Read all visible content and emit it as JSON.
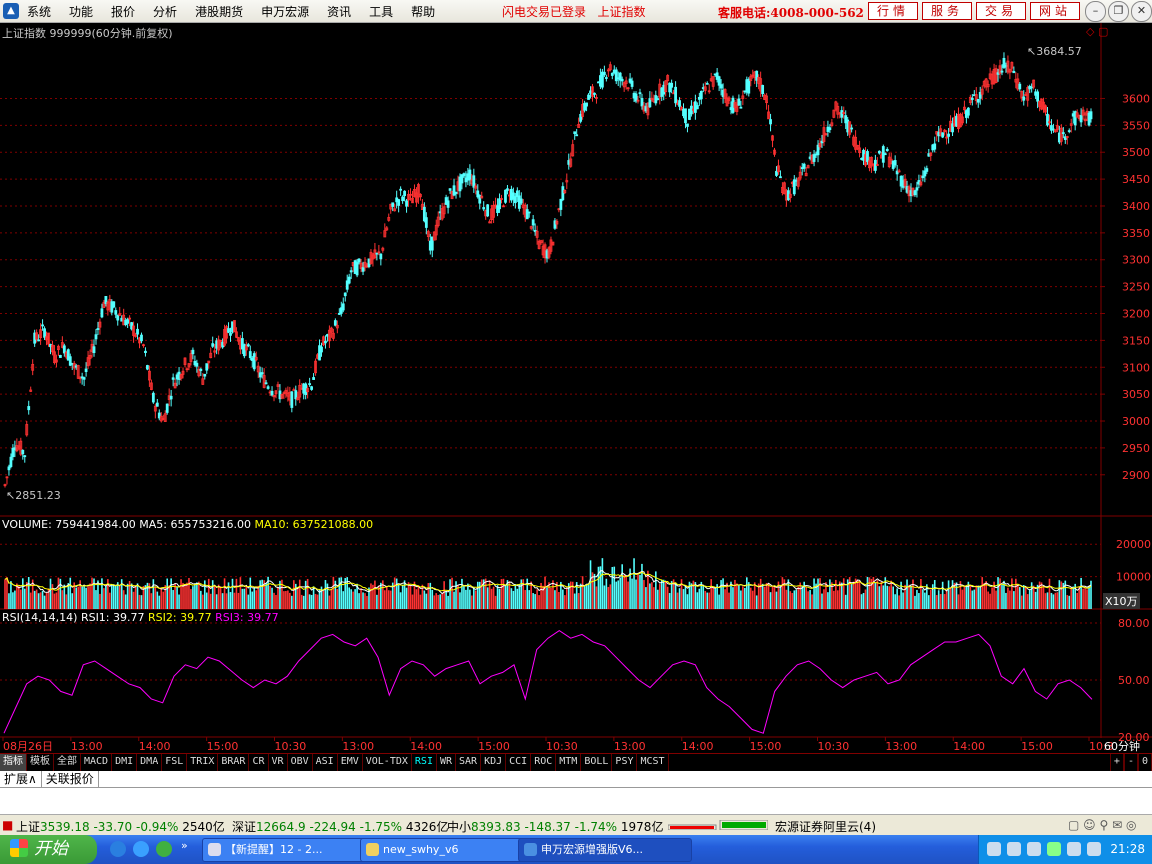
{
  "menubar": {
    "items": [
      "系统",
      "功能",
      "报价",
      "分析",
      "港股期货",
      "申万宏源",
      "资讯",
      "工具",
      "帮助"
    ],
    "login_status": "闪电交易已登录   上证指数",
    "hotline": "客服电话:4008-000-562",
    "quick_buttons": [
      "行情",
      "服务",
      "交易",
      "网站"
    ]
  },
  "chart": {
    "title": "上证指数 999999(60分钟.前复权)",
    "high_label": "3684.57",
    "low_label": "2851.23",
    "volume_header": {
      "volume": "VOLUME: 759441984.00",
      "ma5": "MA5: 655753216.00",
      "ma10": "MA10: 637521088.00"
    },
    "rsi_header": {
      "params": "RSI(14,14,14)",
      "rsi1": "RSI1: 39.77",
      "rsi2": "RSI2: 39.77",
      "rsi3": "RSI3: 39.77"
    },
    "volume_unit": "X10万",
    "time_axis": [
      "08月26日",
      "13:00",
      "14:00",
      "15:00",
      "10:30",
      "13:00",
      "14:00",
      "15:00",
      "10:30",
      "13:00",
      "14:00",
      "15:00",
      "10:30",
      "13:00",
      "14:00",
      "15:00",
      "10:3"
    ],
    "period_label": "60分钟",
    "colors": {
      "up": "#ff3232",
      "down": "#54ffff",
      "grid": "#800000",
      "ma5": "#ffffff",
      "ma10": "#ffff00",
      "rsi": "#ff00ff"
    }
  },
  "chart_data": [
    {
      "type": "candlestick",
      "title": "上证指数 999999(60分钟.前复权)",
      "ylim": [
        2851.23,
        3684.57
      ],
      "y_ticks": [
        2900,
        2950,
        3000,
        3050,
        3100,
        3150,
        3200,
        3250,
        3300,
        3350,
        3400,
        3450,
        3500,
        3550,
        3600
      ],
      "annotations": {
        "high": 3684.57,
        "low": 2851.23
      },
      "close_trajectory": [
        2880,
        2960,
        2940,
        3150,
        3170,
        3120,
        3140,
        3100,
        3080,
        3140,
        3220,
        3210,
        3190,
        3170,
        3140,
        3040,
        3000,
        3070,
        3100,
        3120,
        3080,
        3130,
        3150,
        3180,
        3140,
        3120,
        3080,
        3060,
        3050,
        3040,
        3060,
        3070,
        3140,
        3160,
        3200,
        3280,
        3290,
        3300,
        3310,
        3390,
        3420,
        3410,
        3430,
        3320,
        3380,
        3420,
        3440,
        3460,
        3420,
        3380,
        3400,
        3430,
        3410,
        3380,
        3330,
        3310,
        3390,
        3470,
        3560,
        3600,
        3620,
        3660,
        3640,
        3630,
        3600,
        3580,
        3610,
        3630,
        3600,
        3560,
        3590,
        3620,
        3640,
        3600,
        3580,
        3620,
        3640,
        3600,
        3470,
        3420,
        3440,
        3470,
        3500,
        3540,
        3580,
        3560,
        3520,
        3490,
        3480,
        3500,
        3470,
        3440,
        3420,
        3460,
        3520,
        3540,
        3550,
        3570,
        3600,
        3620,
        3640,
        3660,
        3650,
        3600,
        3620,
        3580,
        3540,
        3530,
        3560,
        3570,
        3560
      ]
    },
    {
      "type": "bar",
      "title": "VOLUME",
      "values": [
        759441984.0
      ],
      "series": [
        {
          "name": "MA5",
          "values": [
            655753216.0
          ]
        },
        {
          "name": "MA10",
          "values": [
            637521088.0
          ]
        }
      ],
      "y_ticks": [
        10000,
        20000
      ],
      "ylabel": "X10万"
    },
    {
      "type": "line",
      "title": "RSI(14,14,14)",
      "ylim": [
        20,
        80
      ],
      "y_ticks": [
        20.0,
        50.0,
        80.0
      ],
      "series": [
        {
          "name": "RSI1",
          "values": [
            22,
            35,
            48,
            52,
            50,
            44,
            42,
            58,
            60,
            56,
            52,
            48,
            46,
            40,
            38,
            52,
            58,
            56,
            62,
            60,
            55,
            50,
            46,
            50,
            48,
            52,
            60,
            66,
            72,
            74,
            70,
            68,
            72,
            62,
            42,
            56,
            60,
            58,
            52,
            56,
            58,
            60,
            48,
            52,
            54,
            58,
            40,
            66,
            72,
            76,
            72,
            74,
            70,
            68,
            62,
            56,
            50,
            46,
            52,
            58,
            60,
            58,
            46,
            40,
            36,
            30,
            24,
            22,
            44,
            52,
            58,
            60,
            56,
            50,
            46,
            50,
            52,
            54,
            48,
            50,
            58,
            62,
            66,
            70,
            70,
            72,
            74,
            68,
            52,
            48,
            56,
            44,
            40,
            48,
            50,
            46,
            39.77
          ]
        }
      ]
    }
  ],
  "indicator_tabs": [
    "指标",
    "模板",
    "全部",
    "MACD",
    "DMI",
    "DMA",
    "FSL",
    "TRIX",
    "BRAR",
    "CR",
    "VR",
    "OBV",
    "ASI",
    "EMV",
    "VOL-TDX",
    "RSI",
    "WR",
    "SAR",
    "KDJ",
    "CCI",
    "ROC",
    "MTM",
    "BOLL",
    "PSY",
    "MCST"
  ],
  "indicator_tabs_right": [
    "+",
    "-",
    "0"
  ],
  "sub_tabs": [
    "扩展∧",
    "关联报价"
  ],
  "statusbar": {
    "sh_name": "上证",
    "sh_value": "3539.18",
    "sh_change": "-33.70",
    "sh_pct": "-0.94%",
    "sh_amount": "2540亿",
    "sz_name": "深证",
    "sz_value": "12664.9",
    "sz_change": "-224.94",
    "sz_pct": "-1.75%",
    "sz_amount": "4326亿",
    "zx_name": "中小",
    "zx_value": "8393.83",
    "zx_change": "-148.37",
    "zx_pct": "-1.74%",
    "zx_amount": "1978亿",
    "server": "宏源证券阿里云(4)"
  },
  "taskbar": {
    "start_label": "开始",
    "tasks": [
      "【新提醒】12 - 2...",
      "new_swhy_v6",
      "申万宏源增强版V6..."
    ],
    "clock": "21:28"
  }
}
